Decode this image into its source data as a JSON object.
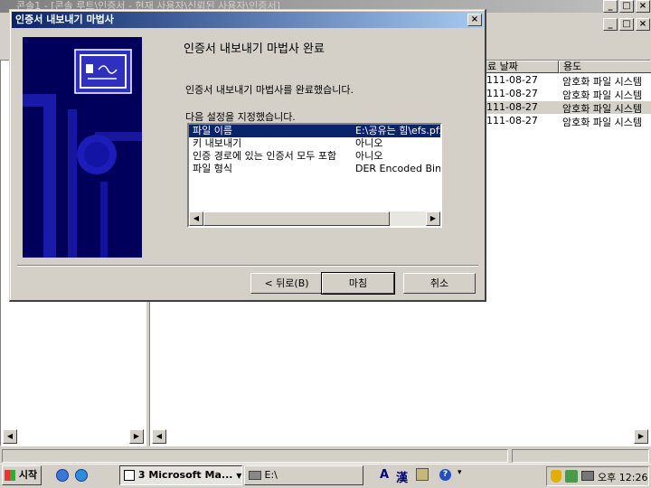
{
  "main_window": {
    "title": "콘솔1 - [콘솔 루트\\인증서 - 현재 사용자\\신뢰된 사용자\\인증서]",
    "list_headers": {
      "expiry": "료 날짜",
      "purpose": "용도"
    },
    "list_rows": [
      {
        "expiry": "111-08-27",
        "purpose": "암호화 파일 시스템"
      },
      {
        "expiry": "111-08-27",
        "purpose": "암호화 파일 시스템"
      },
      {
        "expiry": "111-08-27",
        "purpose": "암호화 파일 시스템"
      },
      {
        "expiry": "111-08-27",
        "purpose": "암호화 파일 시스템"
      }
    ]
  },
  "wizard": {
    "title": "인증서 내보내기 마법사",
    "heading": "인증서 내보내기 마법사 완료",
    "completed_text": "인증서 내보내기 마법사를 완료했습니다.",
    "settings_label": "다음 설정을 지정했습니다.",
    "settings": [
      {
        "name": "파일 이름",
        "value": "E:\\공유는 힘\\efs.pfx"
      },
      {
        "name": "키 내보내기",
        "value": "아니오"
      },
      {
        "name": "인증 경로에 있는 인증서 모두 포함",
        "value": "아니오"
      },
      {
        "name": "파일 형식",
        "value": "DER Encoded Bina"
      }
    ],
    "back_label": "< 뒤로(B)",
    "finish_label": "마침",
    "cancel_label": "취소"
  },
  "taskbar": {
    "start_label": "시작",
    "task1": "3 Microsoft Ma...",
    "task2": "E:\\",
    "ime1": "A",
    "ime2": "漢",
    "clock": "오후 12:26"
  }
}
